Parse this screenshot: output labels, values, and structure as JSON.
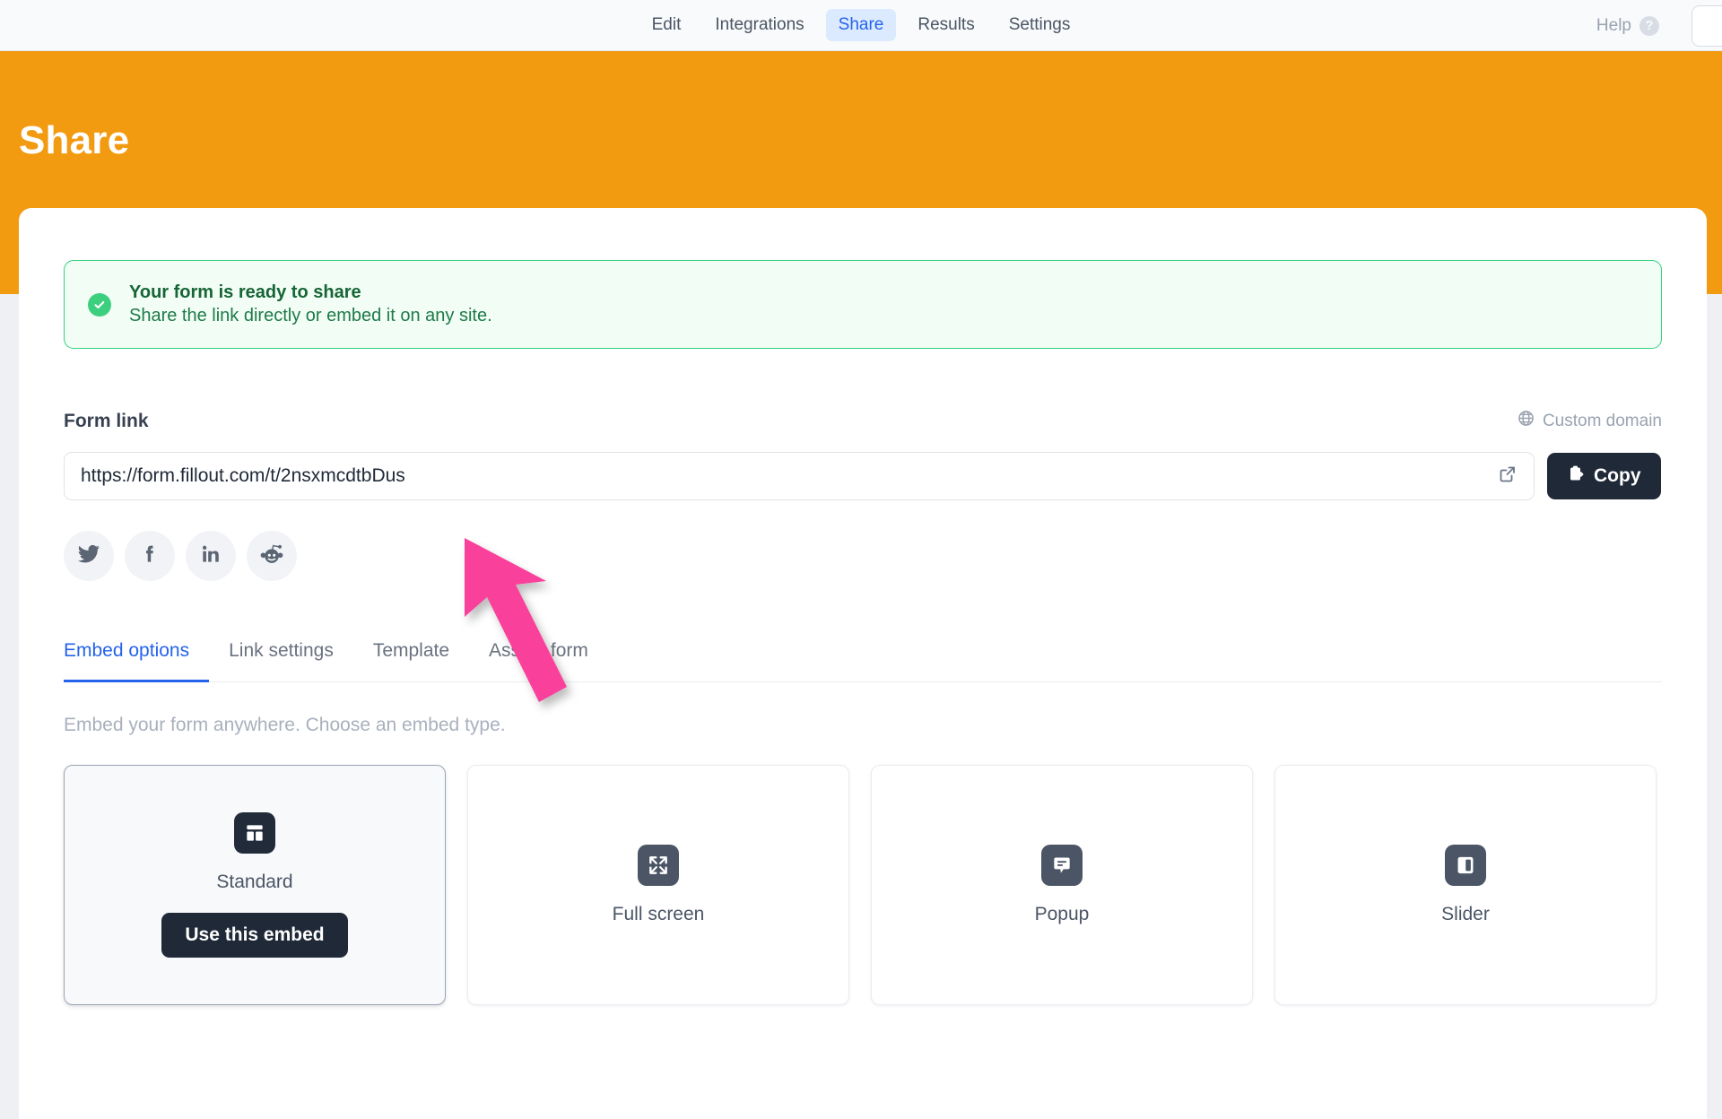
{
  "topnav": {
    "items": [
      {
        "label": "Edit",
        "active": false
      },
      {
        "label": "Integrations",
        "active": false
      },
      {
        "label": "Share",
        "active": true
      },
      {
        "label": "Results",
        "active": false
      },
      {
        "label": "Settings",
        "active": false
      }
    ],
    "help_label": "Help",
    "help_icon": "question-mark-circle-icon"
  },
  "header": {
    "title": "Share",
    "band_color": "#f29a10"
  },
  "success": {
    "icon": "check-circle-icon",
    "title": "Your form is ready to share",
    "subtitle": "Share the link directly or embed it on any site.",
    "border_color": "#34d17f",
    "bg_color": "#f2fdf6"
  },
  "form_link": {
    "label": "Form link",
    "custom_domain_label": "Custom domain",
    "custom_domain_icon": "globe-icon",
    "url": "https://form.fillout.com/t/2nsxmcdtbDus",
    "open_icon": "external-link-icon",
    "copy_label": "Copy",
    "copy_icon": "clipboard-icon"
  },
  "social": [
    {
      "name": "twitter-icon",
      "label": "Twitter"
    },
    {
      "name": "facebook-icon",
      "label": "Facebook"
    },
    {
      "name": "linkedin-icon",
      "label": "LinkedIn"
    },
    {
      "name": "reddit-icon",
      "label": "Reddit"
    }
  ],
  "tabs": [
    {
      "label": "Embed options",
      "active": true
    },
    {
      "label": "Link settings",
      "active": false
    },
    {
      "label": "Template",
      "active": false
    },
    {
      "label": "Assign form",
      "active": false
    }
  ],
  "embed": {
    "description": "Embed your form anywhere. Choose an embed type.",
    "use_embed_label": "Use this embed",
    "options": [
      {
        "label": "Standard",
        "icon": "layout-panels-icon",
        "selected": true
      },
      {
        "label": "Full screen",
        "icon": "expand-arrows-icon",
        "selected": false
      },
      {
        "label": "Popup",
        "icon": "message-bubble-icon",
        "selected": false
      },
      {
        "label": "Slider",
        "icon": "side-panel-icon",
        "selected": false
      }
    ]
  },
  "cursor": {
    "name": "pink-arrow-cursor",
    "color": "#f9409b"
  }
}
